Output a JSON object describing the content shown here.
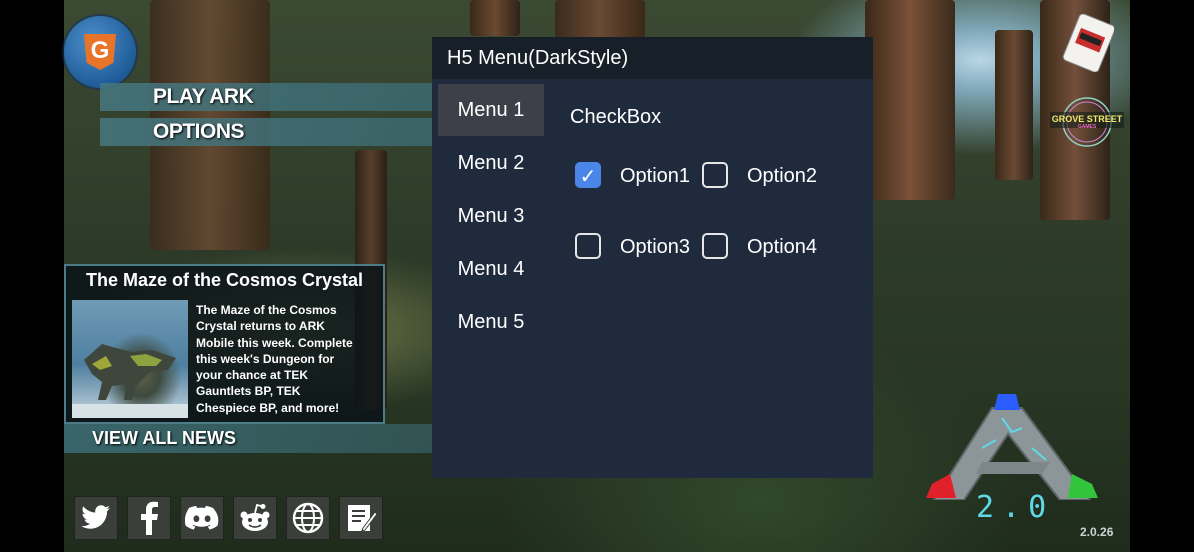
{
  "logos": {
    "g_letter": "G",
    "grove_text_1": "GROVE STREET",
    "grove_text_2": "GAMES"
  },
  "main_menu": {
    "items": [
      {
        "label": "PLAY ARK"
      },
      {
        "label": "OPTIONS"
      }
    ]
  },
  "news": {
    "title": "The Maze of the Cosmos Crystal",
    "body_lines": [
      "The Maze of the Cosmos",
      "Crystal returns to ARK",
      "Mobile this week. Complete",
      "this week's Dungeon for",
      "your chance at TEK",
      "Gauntlets BP, TEK",
      "Chespiece BP, and more!"
    ],
    "view_all_label": "VIEW ALL NEWS"
  },
  "social_icons": [
    {
      "icon": "twitter-icon"
    },
    {
      "icon": "facebook-icon"
    },
    {
      "icon": "discord-icon"
    },
    {
      "icon": "reddit-icon"
    },
    {
      "icon": "globe-icon"
    },
    {
      "icon": "notes-icon"
    }
  ],
  "mod_menu": {
    "title": "H5 Menu(DarkStyle)",
    "tabs": [
      {
        "label": "Menu 1",
        "active": true
      },
      {
        "label": "Menu 2",
        "active": false
      },
      {
        "label": "Menu 3",
        "active": false
      },
      {
        "label": "Menu 4",
        "active": false
      },
      {
        "label": "Menu 5",
        "active": false
      }
    ],
    "section_heading": "CheckBox",
    "checkboxes": [
      {
        "label": "Option1",
        "checked": true
      },
      {
        "label": "Option2",
        "checked": false
      },
      {
        "label": "Option3",
        "checked": false
      },
      {
        "label": "Option4",
        "checked": false
      }
    ],
    "check_glyph": "✓"
  },
  "ark_logo": {
    "text": "2.0"
  },
  "version": "2.0.26",
  "colors": {
    "panel_bg": "#1f2a3d",
    "panel_header_bg": "#172028",
    "active_tab_bg": "#3d4048",
    "checkbox_checked": "#4a86e8",
    "menu_bar_teal": "#467882"
  }
}
